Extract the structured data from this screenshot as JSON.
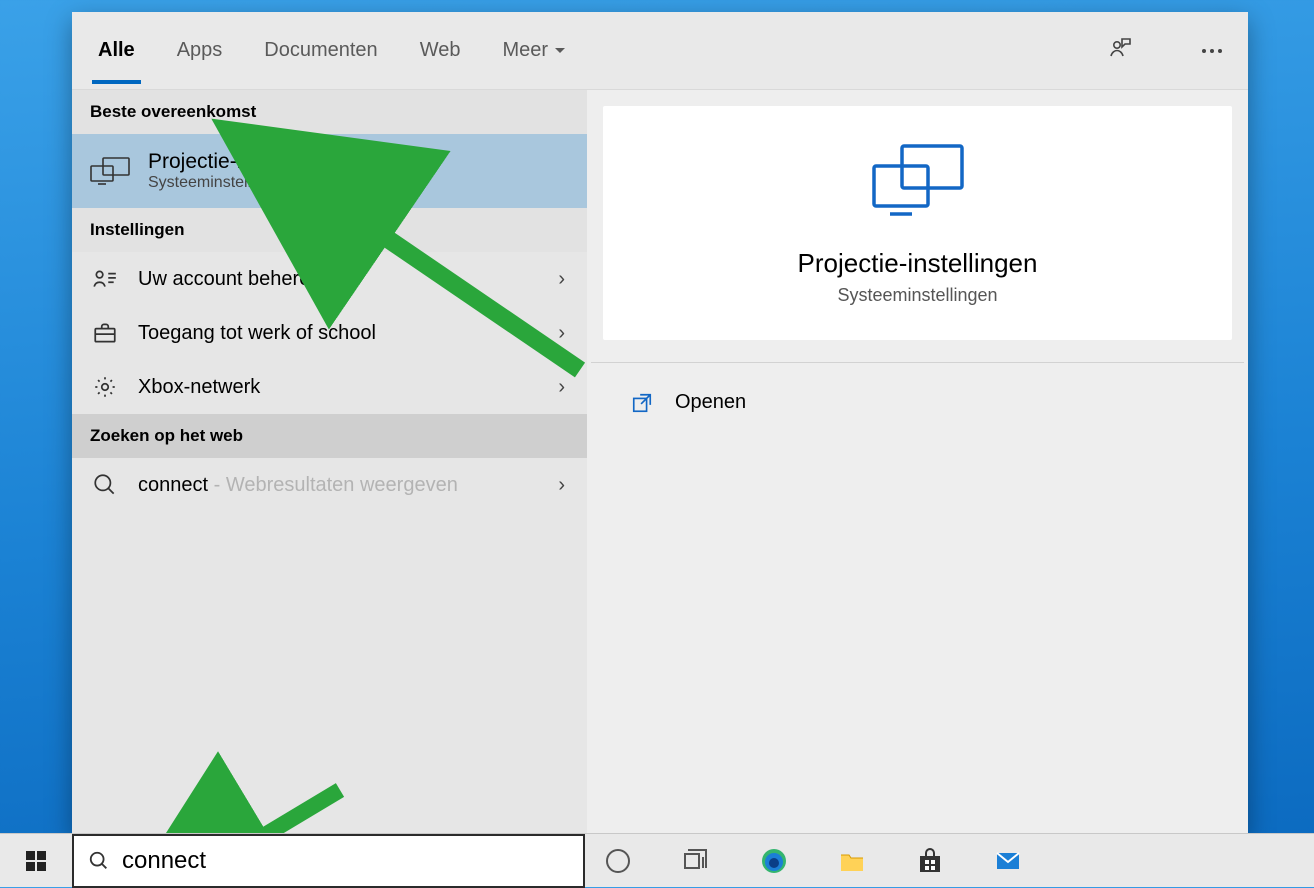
{
  "tabs": {
    "all": "Alle",
    "apps": "Apps",
    "documents": "Documenten",
    "web": "Web",
    "more": "Meer"
  },
  "sections": {
    "best_match": "Beste overeenkomst",
    "settings": "Instellingen",
    "search_web": "Zoeken op het web"
  },
  "best": {
    "title": "Projectie-instellingen",
    "subtitle": "Systeeminstellingen"
  },
  "settings_items": {
    "account": "Uw account beheren",
    "work": "Toegang tot werk of school",
    "xbox": "Xbox-netwerk"
  },
  "web": {
    "term": "connect",
    "suffix": " - Webresultaten weergeven"
  },
  "detail": {
    "title": "Projectie-instellingen",
    "subtitle": "Systeeminstellingen",
    "action_open": "Openen"
  },
  "search": {
    "value": "connect"
  },
  "colors": {
    "accent": "#0067c0",
    "brand_blue": "#1267c5",
    "arrow_green": "#2aa63b"
  }
}
